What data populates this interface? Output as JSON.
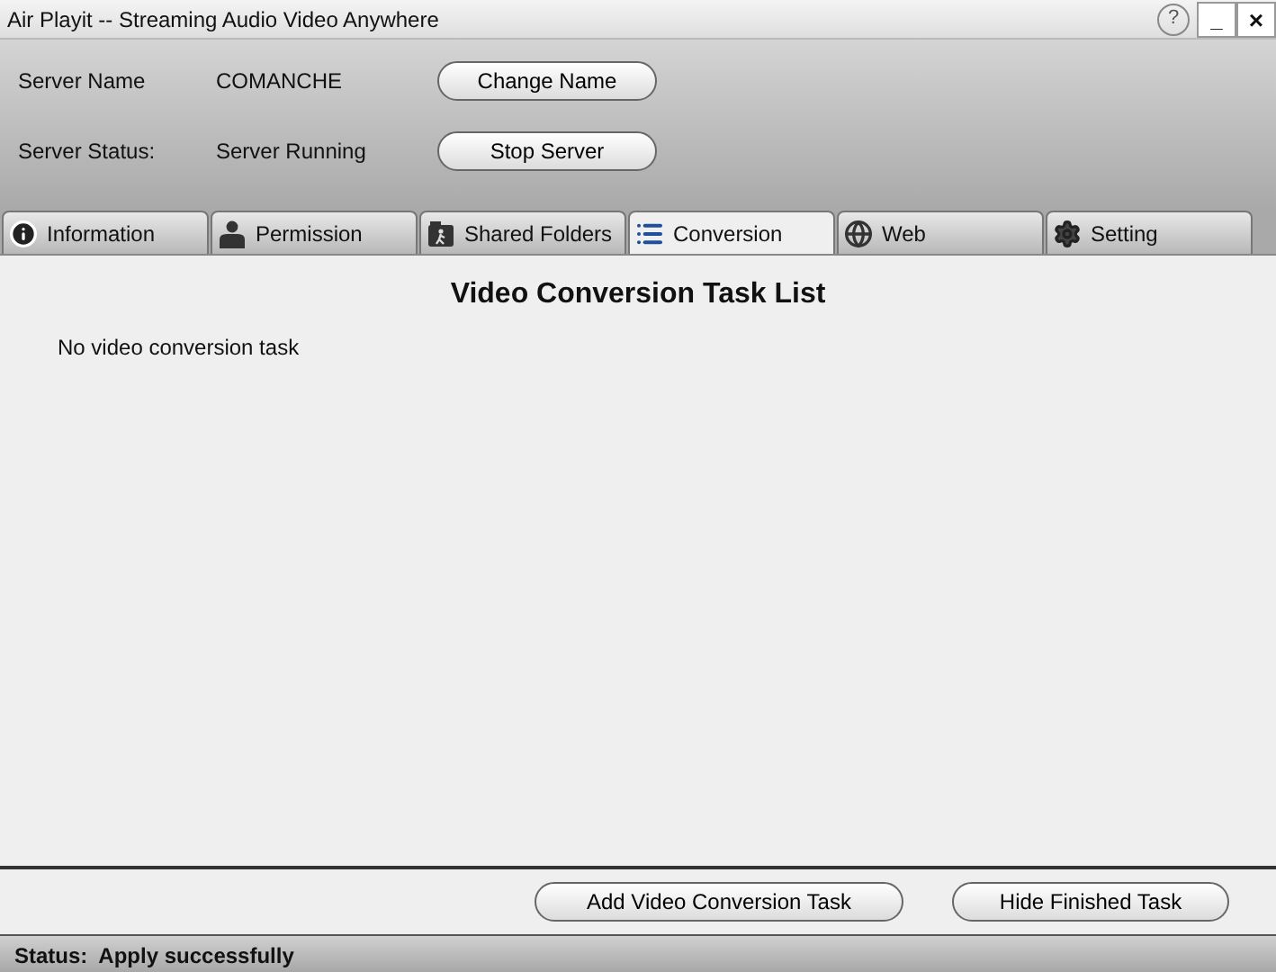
{
  "window": {
    "title": "Air Playit -- Streaming Audio Video Anywhere",
    "controls": [
      "?",
      "_",
      "×"
    ]
  },
  "server": {
    "rows": [
      {
        "label": "Server Name",
        "value": "COMANCHE",
        "button": "Change Name"
      },
      {
        "label": "Server Status:",
        "value": "Server Running",
        "button": "Stop Server"
      }
    ]
  },
  "tabs": [
    {
      "kind": "info",
      "label": "Information",
      "selected": false
    },
    {
      "kind": "person",
      "label": "Permission",
      "selected": false
    },
    {
      "kind": "folder",
      "label": "Shared Folders",
      "selected": false
    },
    {
      "kind": "list",
      "label": "Conversion",
      "selected": true
    },
    {
      "kind": "globe",
      "label": "Web",
      "selected": false
    },
    {
      "kind": "gear",
      "label": "Setting",
      "selected": false
    }
  ],
  "content": {
    "heading": "Video Conversion Task List",
    "empty_message": "No video conversion task",
    "buttons": [
      "Add Video Conversion Task",
      "Hide Finished Task"
    ]
  },
  "status_bar": {
    "label": "Status:",
    "value": "Apply successfully"
  }
}
